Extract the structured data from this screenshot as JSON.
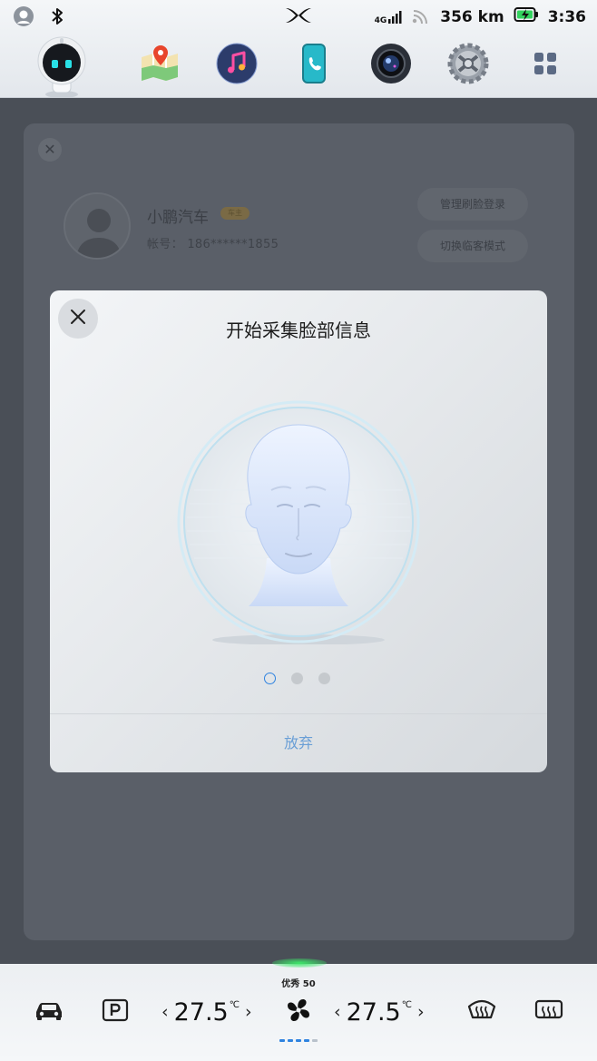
{
  "status_bar": {
    "network": "4G",
    "range": "356 km",
    "time": "3:36"
  },
  "dock": {
    "apps": [
      "assistant",
      "map",
      "music",
      "phone",
      "camera",
      "settings",
      "app-grid"
    ]
  },
  "background_profile": {
    "name": "小鹏汽车",
    "badge": "车主",
    "account_label": "帐号：",
    "account_value": "186******1855",
    "manage_face_login": "管理刷脸登录",
    "guest_mode": "切换临客模式"
  },
  "modal": {
    "title": "开始采集脸部信息",
    "steps_total": 3,
    "current_step": 1,
    "abandon_label": "放弃"
  },
  "climate": {
    "air_quality": "优秀 50",
    "left_temp": "27.5",
    "right_temp": "27.5",
    "temp_unit": "℃",
    "fan_level_fraction": 0.8,
    "left_arrow": "‹",
    "right_arrow": "›"
  },
  "colors": {
    "accent": "#2f83e0",
    "modal_bg": "#eceff2",
    "overlay_bg": "#4a4f57"
  }
}
